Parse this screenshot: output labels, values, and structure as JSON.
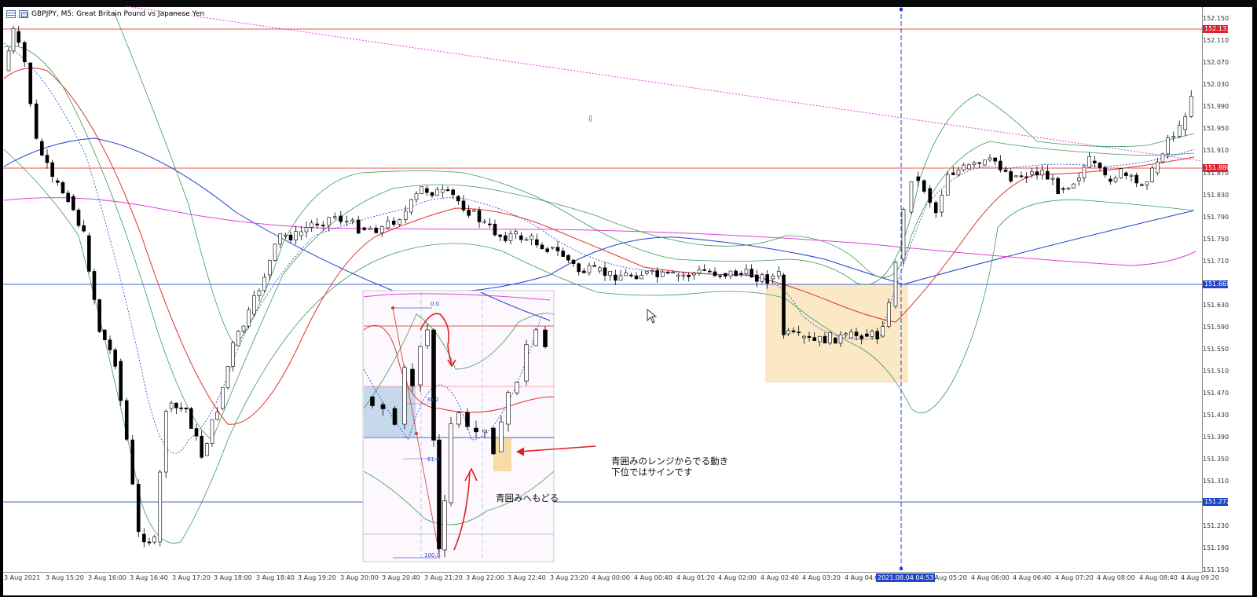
{
  "window": {
    "title": "GBPJPY, M5:  Great Britain Pound vs Japanese Yen"
  },
  "price_axis": {
    "ticks": [
      "152.150",
      "152.110",
      "152.070",
      "152.030",
      "151.990",
      "151.950",
      "151.910",
      "151.870",
      "151.830",
      "151.790",
      "151.750",
      "151.710",
      "151.630",
      "151.590",
      "151.550",
      "151.510",
      "151.470",
      "151.430",
      "151.390",
      "151.350",
      "151.310",
      "151.230",
      "151.190",
      "151.150"
    ],
    "highlighted": [
      {
        "label": "152.133",
        "color": "#e0202a"
      },
      {
        "label": "151.880",
        "color": "#e0202a"
      },
      {
        "label": "151.668",
        "color": "#2346c8"
      },
      {
        "label": "151.272",
        "color": "#2346c8"
      }
    ]
  },
  "time_axis": {
    "labels": [
      "3 Aug 2021",
      "3 Aug 15:20",
      "3 Aug 16:00",
      "3 Aug 16:40",
      "3 Aug 17:20",
      "3 Aug 18:00",
      "3 Aug 18:40",
      "3 Aug 19:20",
      "3 Aug 20:00",
      "3 Aug 20:40",
      "3 Aug 21:20",
      "3 Aug 22:00",
      "3 Aug 22:40",
      "3 Aug 23:20",
      "4 Aug 00:00",
      "4 Aug 00:40",
      "4 Aug 01:20",
      "4 Aug 02:00",
      "4 Aug 02:40",
      "4 Aug 03:20",
      "4 Aug 04:00",
      "4 Aug 05:20",
      "4 Aug 06:00",
      "4 Aug 06:40",
      "4 Aug 07:20",
      "4 Aug 08:00",
      "4 Aug 08:40",
      "4 Aug 09:20"
    ],
    "crosshair": "2021.08.04 04:53"
  },
  "inset": {
    "fib_levels": [
      "0.0",
      "38.2",
      "61.8",
      "100.0"
    ],
    "note": "青囲みへもどる"
  },
  "annotation": {
    "line1": "青囲みのレンジからでる動き",
    "line2": "下位ではサインです"
  },
  "colors": {
    "bull": "#ffffff",
    "bear": "#000000",
    "bands": "#3a9a5a",
    "ma_red": "#e03030",
    "ma_blue": "#2040d0",
    "ma_magenta": "#e040e0",
    "range_box": "#fbe9c6",
    "level_red": "#f05050",
    "level_blue": "#4060e0"
  },
  "icons": {
    "down_arrow": "⇩",
    "cursor": "mouse-pointer-icon"
  }
}
